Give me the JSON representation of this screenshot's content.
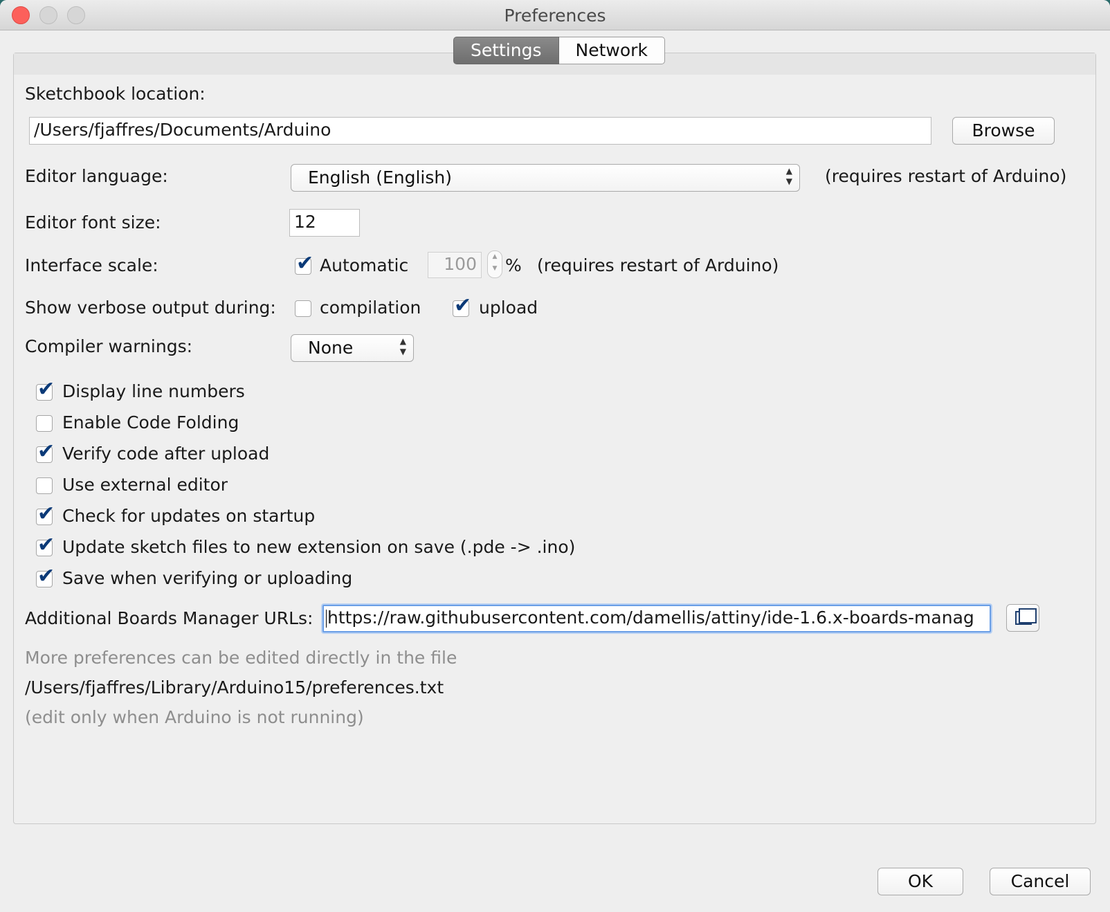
{
  "window": {
    "title": "Preferences"
  },
  "tabs": [
    {
      "label": "Settings",
      "active": true
    },
    {
      "label": "Network",
      "active": false
    }
  ],
  "sketchbook": {
    "label": "Sketchbook location:",
    "value": "/Users/fjaffres/Documents/Arduino",
    "browse_label": "Browse"
  },
  "editor_language": {
    "label": "Editor language:",
    "selected": "English (English)",
    "note": "(requires restart of Arduino)"
  },
  "font_size": {
    "label": "Editor font size:",
    "value": "12"
  },
  "interface_scale": {
    "label": "Interface scale:",
    "automatic_label": "Automatic",
    "automatic_checked": true,
    "value": "100",
    "unit": "%",
    "note": "(requires restart of Arduino)"
  },
  "verbose": {
    "label": "Show verbose output during:",
    "compilation_label": "compilation",
    "compilation_checked": false,
    "upload_label": "upload",
    "upload_checked": true
  },
  "compiler_warnings": {
    "label": "Compiler warnings:",
    "selected": "None"
  },
  "options": [
    {
      "label": "Display line numbers",
      "checked": true
    },
    {
      "label": "Enable Code Folding",
      "checked": false
    },
    {
      "label": "Verify code after upload",
      "checked": true
    },
    {
      "label": "Use external editor",
      "checked": false
    },
    {
      "label": "Check for updates on startup",
      "checked": true
    },
    {
      "label": "Update sketch files to new extension on save (.pde -> .ino)",
      "checked": true
    },
    {
      "label": "Save when verifying or uploading",
      "checked": true
    }
  ],
  "boards_manager": {
    "label": "Additional Boards Manager URLs:",
    "value": "https://raw.githubusercontent.com/damellis/attiny/ide-1.6.x-boards-manag"
  },
  "footer": {
    "more_text": "More preferences can be edited directly in the file",
    "path": "/Users/fjaffres/Library/Arduino15/preferences.txt",
    "note": "(edit only when Arduino is not running)"
  },
  "buttons": {
    "ok": "OK",
    "cancel": "Cancel"
  },
  "icons": {
    "check": "✔",
    "updown": "▲▼"
  }
}
